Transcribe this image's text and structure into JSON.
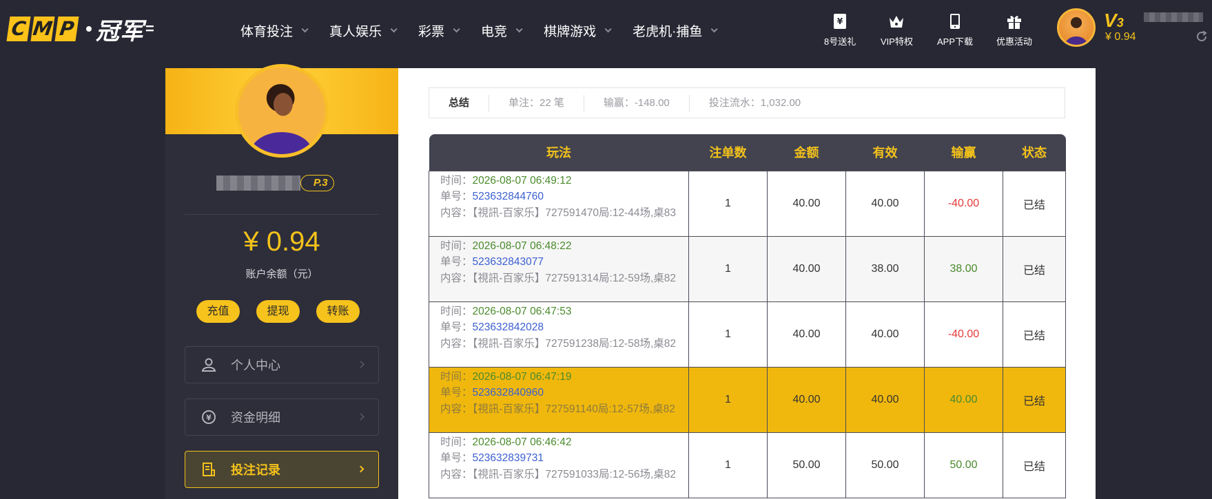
{
  "header": {
    "logo_letters": [
      "C",
      "M",
      "P"
    ],
    "logo_cn": "冠军",
    "nav": [
      {
        "label": "体育投注"
      },
      {
        "label": "真人娱乐"
      },
      {
        "label": "彩票"
      },
      {
        "label": "电竞"
      },
      {
        "label": "棋牌游戏"
      },
      {
        "label": "老虎机·捕鱼"
      }
    ],
    "quick_links": [
      {
        "label": "8号送礼",
        "icon": "gift-ticket-icon"
      },
      {
        "label": "VIP特权",
        "icon": "crown-icon"
      },
      {
        "label": "APP下载",
        "icon": "phone-icon"
      },
      {
        "label": "优惠活动",
        "icon": "gift-box-icon"
      }
    ],
    "vip": "V",
    "vip_level": "3",
    "balance": "¥ 0.94"
  },
  "sidebar": {
    "vip_badge": "P.3",
    "balance": "¥ 0.94",
    "balance_label": "账户余额（元）",
    "actions": [
      "充值",
      "提现",
      "转账"
    ],
    "menu": [
      {
        "label": "个人中心",
        "icon": "user-icon"
      },
      {
        "label": "资金明细",
        "icon": "money-cycle-icon"
      },
      {
        "label": "投注记录",
        "icon": "bet-record-icon",
        "active": true
      }
    ]
  },
  "summary": {
    "total": "总结",
    "bets": "单注：22 笔",
    "winloss": "输赢：-148.00",
    "turnover": "投注流水：1,032.00"
  },
  "table": {
    "headers": [
      "玩法",
      "注单数",
      "金额",
      "有效",
      "输赢",
      "状态"
    ],
    "labels": {
      "time": "时间：",
      "no": "单号：",
      "content": "内容："
    },
    "rows": [
      {
        "time": "2026-08-07 06:49:12",
        "no": "523632844760",
        "content": "【視訊-百家乐】727591470局:12-44场,桌83",
        "count": "1",
        "amount": "40.00",
        "valid": "40.00",
        "winloss": "-40.00",
        "status": "已结"
      },
      {
        "time": "2026-08-07 06:48:22",
        "no": "523632843077",
        "content": "【視訊-百家乐】727591314局:12-59场,桌82",
        "count": "1",
        "amount": "40.00",
        "valid": "38.00",
        "winloss": "38.00",
        "status": "已结"
      },
      {
        "time": "2026-08-07 06:47:53",
        "no": "523632842028",
        "content": "【視訊-百家乐】727591238局:12-58场,桌82",
        "count": "1",
        "amount": "40.00",
        "valid": "40.00",
        "winloss": "-40.00",
        "status": "已结"
      },
      {
        "time": "2026-08-07 06:47:19",
        "no": "523632840960",
        "content": "【視訊-百家乐】727591140局:12-57场,桌82",
        "count": "1",
        "amount": "40.00",
        "valid": "40.00",
        "winloss": "40.00",
        "status": "已结"
      },
      {
        "time": "2026-08-07 06:46:42",
        "no": "523632839731",
        "content": "【視訊-百家乐】727591033局:12-56场,桌82",
        "count": "1",
        "amount": "50.00",
        "valid": "50.00",
        "winloss": "50.00",
        "status": "已结"
      }
    ]
  },
  "colors": {
    "accent": "#f4c21b",
    "bg": "#272834",
    "panel": "#2d2e3a",
    "negative": "#e53a3a",
    "positive": "#4a8a2c",
    "link": "#3a5fd1"
  }
}
